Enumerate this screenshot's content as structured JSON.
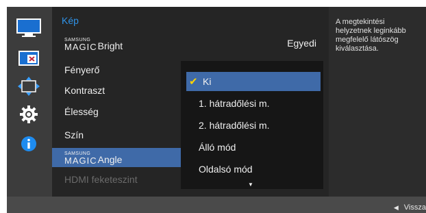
{
  "menu": {
    "title": "Kép",
    "items": [
      {
        "magic": true,
        "brand": "SAMSUNG",
        "magic_word": "MAGIC",
        "label": "Bright",
        "value": "Egyedi"
      },
      {
        "label": "Fényerő"
      },
      {
        "label": "Kontraszt"
      },
      {
        "label": "Élesség"
      },
      {
        "label": "Szín"
      },
      {
        "magic": true,
        "brand": "SAMSUNG",
        "magic_word": "MAGIC",
        "label": "Angle",
        "selected": true
      },
      {
        "label": "HDMI feketeszint",
        "disabled": true
      }
    ]
  },
  "dropdown": {
    "options": [
      "Ki",
      "1. hátradőlési m.",
      "2. hátradőlési m.",
      "Álló mód",
      "Oldalsó mód"
    ],
    "selected_index": 0
  },
  "description": "A megtekintési helyzetnek leginkább megfelelő látószög kiválasztása.",
  "footer": {
    "back_label": "Vissza"
  },
  "icons": [
    "picture-icon",
    "screen-adjust-icon",
    "display-position-icon",
    "settings-gear-icon",
    "info-icon"
  ],
  "colors": {
    "accent": "#2f93e8",
    "selection": "#3f6aa8",
    "checkmark": "#ffd400"
  }
}
